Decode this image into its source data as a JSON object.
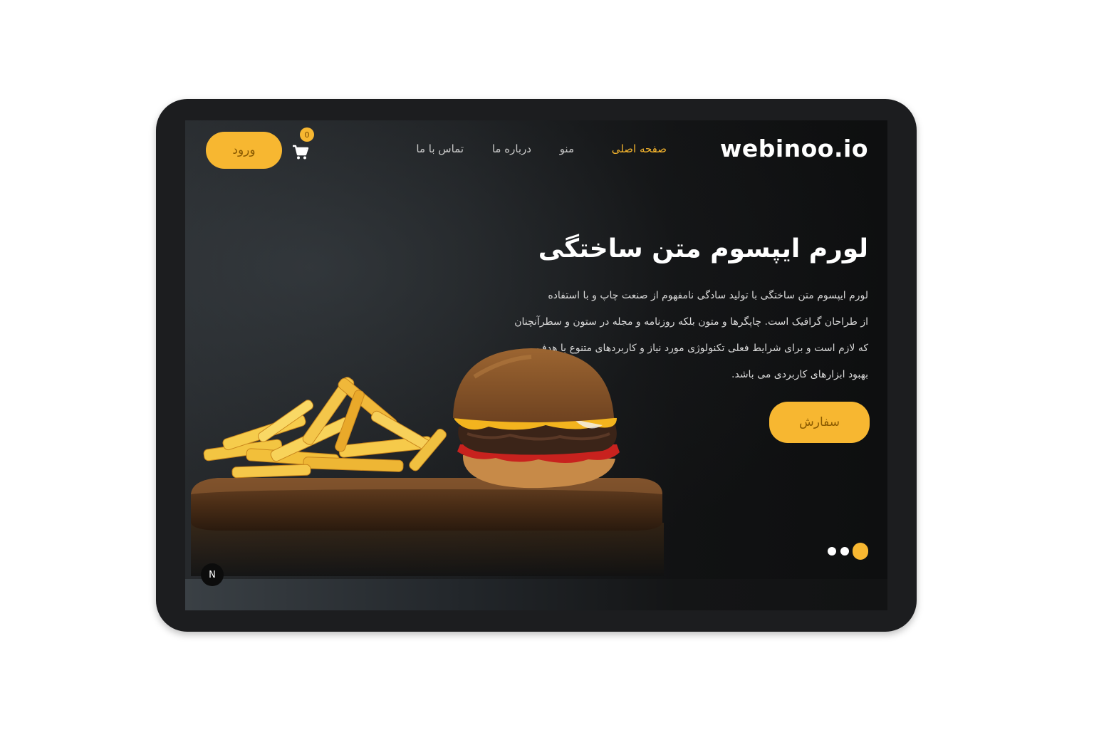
{
  "brand": {
    "logo": "webinoo.io"
  },
  "nav": {
    "items": [
      {
        "label": "صفحه اصلی",
        "active": true
      },
      {
        "label": "منو",
        "active": false
      },
      {
        "label": "درباره ما",
        "active": false
      },
      {
        "label": "تماس با ما",
        "active": false
      }
    ]
  },
  "header": {
    "login_label": "ورود",
    "cart_count": "0"
  },
  "hero": {
    "title": "لورم ایپسوم متن ساختگی",
    "lines": [
      "لورم ایپسوم متن ساختگی با تولید سادگی نامفهوم از صنعت چاپ و با استفاده",
      "از طراحان گرافیک است. چاپگرها و متون بلکه روزنامه و مجله در ستون و سطرآنچنان",
      "که لازم است و برای شرایط فعلی تکنولوژی مورد نیاز و کاربردهای متنوع با هدف",
      "بهبود ابزارهای کاربردی می باشد."
    ],
    "cta_label": "سفارش"
  },
  "carousel": {
    "total": 3,
    "active": 1
  },
  "corner_badge": "N",
  "colors": {
    "accent": "#f7b731",
    "screen_bg": "#111213",
    "frame": "#1c1d1f"
  }
}
